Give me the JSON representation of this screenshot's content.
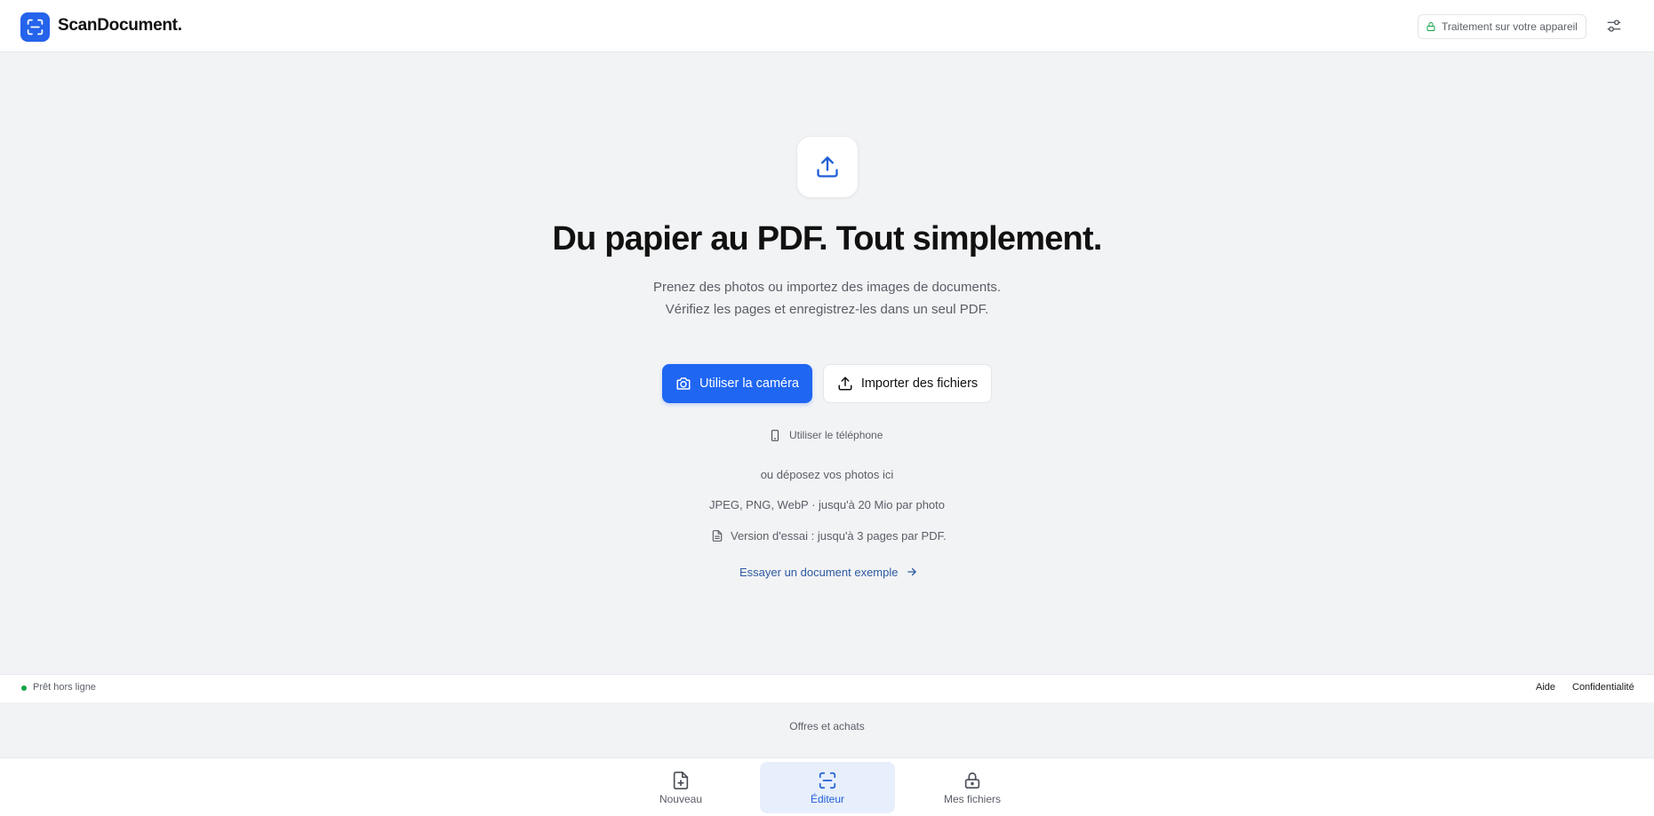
{
  "header": {
    "brand": "ScanDocument.",
    "logo_icon": "scan-icon",
    "device_badge": "Traitement sur votre appareil",
    "device_icon": "lock-icon",
    "settings_icon": "sliders-icon"
  },
  "hero": {
    "upload_icon": "upload-icon",
    "headline": "Du papier au PDF. Tout simplement.",
    "subtitle": "Prenez des photos ou importez des images de documents. Vérifiez les pages et enregistrez-les dans un seul PDF."
  },
  "actions": {
    "camera_label": "Utiliser la caméra",
    "camera_icon": "camera-icon",
    "import_label": "Importer des fichiers",
    "import_icon": "upload-icon",
    "phone_label": "Utiliser le téléphone",
    "phone_icon": "smartphone-icon"
  },
  "dropzone": {
    "drop_text": "ou déposez vos photos ici",
    "formats": "JPEG, PNG, WebP · jusqu'à 20 Mio par photo",
    "trial_note": "Version d'essai : jusqu'à 3 pages par PDF.",
    "sample_link": "Essayer un document exemple"
  },
  "status_bar": {
    "status": "Prêt hors ligne",
    "help": "Aide",
    "privacy": "Confidentialité"
  },
  "offers": "Offres et achats",
  "bottom_nav": {
    "items": [
      {
        "label": "Nouveau",
        "icon": "file-plus-icon",
        "active": false
      },
      {
        "label": "Éditeur",
        "icon": "scan-icon",
        "active": true
      },
      {
        "label": "Mes fichiers",
        "icon": "lock-icon",
        "active": false
      }
    ]
  },
  "colors": {
    "accent": "#1f66f2",
    "background": "#f2f3f5",
    "status_online": "#15a34a",
    "link": "#2c5aa0"
  }
}
